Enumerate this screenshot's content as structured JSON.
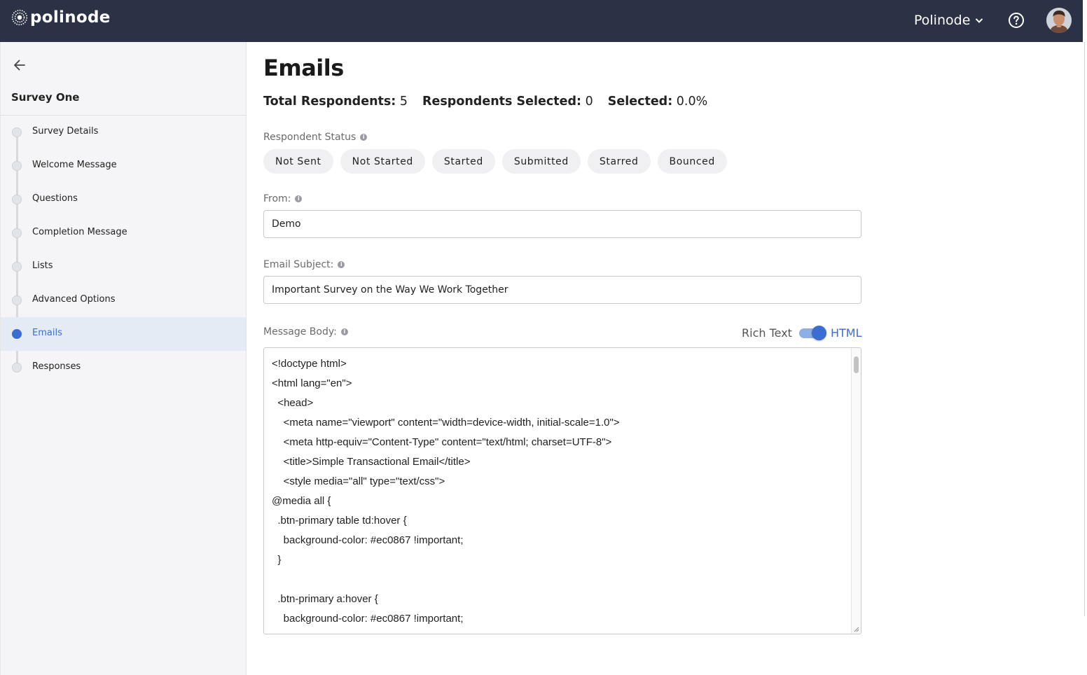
{
  "topbar": {
    "logo_text": "polinode",
    "org_name": "Polinode"
  },
  "sidebar": {
    "survey_title": "Survey One",
    "steps": [
      {
        "label": "Survey Details",
        "active": false
      },
      {
        "label": "Welcome Message",
        "active": false
      },
      {
        "label": "Questions",
        "active": false
      },
      {
        "label": "Completion Message",
        "active": false
      },
      {
        "label": "Lists",
        "active": false
      },
      {
        "label": "Advanced Options",
        "active": false
      },
      {
        "label": "Emails",
        "active": true
      },
      {
        "label": "Responses",
        "active": false
      }
    ]
  },
  "main": {
    "title": "Emails",
    "stats": {
      "total_label": "Total Respondents:",
      "total_value": "5",
      "selected_label": "Respondents Selected:",
      "selected_value": "0",
      "pct_label": "Selected:",
      "pct_value": "0.0%"
    },
    "respondent_status": {
      "label": "Respondent Status",
      "chips": [
        "Not Sent",
        "Not Started",
        "Started",
        "Submitted",
        "Starred",
        "Bounced"
      ]
    },
    "from": {
      "label": "From:",
      "value": "Demo"
    },
    "subject": {
      "label": "Email Subject:",
      "value": "Important Survey on the Way We Work Together"
    },
    "body": {
      "label": "Message Body:",
      "mode_rich": "Rich Text",
      "mode_html": "HTML",
      "html_mode_on": true,
      "code_lines": [
        "<!doctype html>",
        "<html lang=\"en\">",
        "  <head>",
        "    <meta name=\"viewport\" content=\"width=device-width, initial-scale=1.0\">",
        "    <meta http-equiv=\"Content-Type\" content=\"text/html; charset=UTF-8\">",
        "    <title>Simple Transactional Email</title>",
        "    <style media=\"all\" type=\"text/css\">",
        "@media all {",
        "  .btn-primary table td:hover {",
        "    background-color: #ec0867 !important;",
        "  }",
        "",
        "  .btn-primary a:hover {",
        "    background-color: #ec0867 !important;"
      ]
    }
  },
  "colors": {
    "topbar": "#2b3245",
    "accent": "#3a6ed0",
    "active_row": "#e4ebf5"
  },
  "icons": {
    "logo": "polinode-logo-icon",
    "org_dropdown": "chevron-down-icon",
    "help": "help-circle-icon",
    "back": "arrow-left-icon",
    "info": "info-icon"
  }
}
